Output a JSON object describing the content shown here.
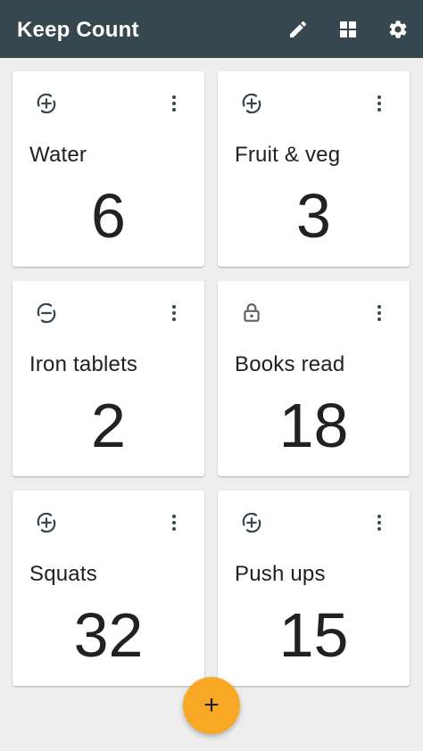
{
  "app": {
    "title": "Keep Count"
  },
  "toolbar": {
    "actions": [
      {
        "icon": "pencil-icon",
        "label": "Edit"
      },
      {
        "icon": "grid-view-icon",
        "label": "Layout"
      },
      {
        "icon": "gear-icon",
        "label": "Settings"
      }
    ]
  },
  "counters": [
    {
      "name": "Water",
      "value": "6",
      "mode_icon": "plus-cycle-icon"
    },
    {
      "name": "Fruit & veg",
      "value": "3",
      "mode_icon": "plus-cycle-icon"
    },
    {
      "name": "Iron tablets",
      "value": "2",
      "mode_icon": "minus-cycle-icon"
    },
    {
      "name": "Books read",
      "value": "18",
      "mode_icon": "lock-icon"
    },
    {
      "name": "Squats",
      "value": "32",
      "mode_icon": "plus-cycle-icon"
    },
    {
      "name": "Push ups",
      "value": "15",
      "mode_icon": "plus-cycle-icon"
    }
  ],
  "fab": {
    "icon": "plus-icon",
    "symbol": "+"
  },
  "colors": {
    "appbar": "#37474f",
    "background": "#eeeeee",
    "card": "#ffffff",
    "fab": "#f9a825",
    "icon": "#37474f"
  }
}
